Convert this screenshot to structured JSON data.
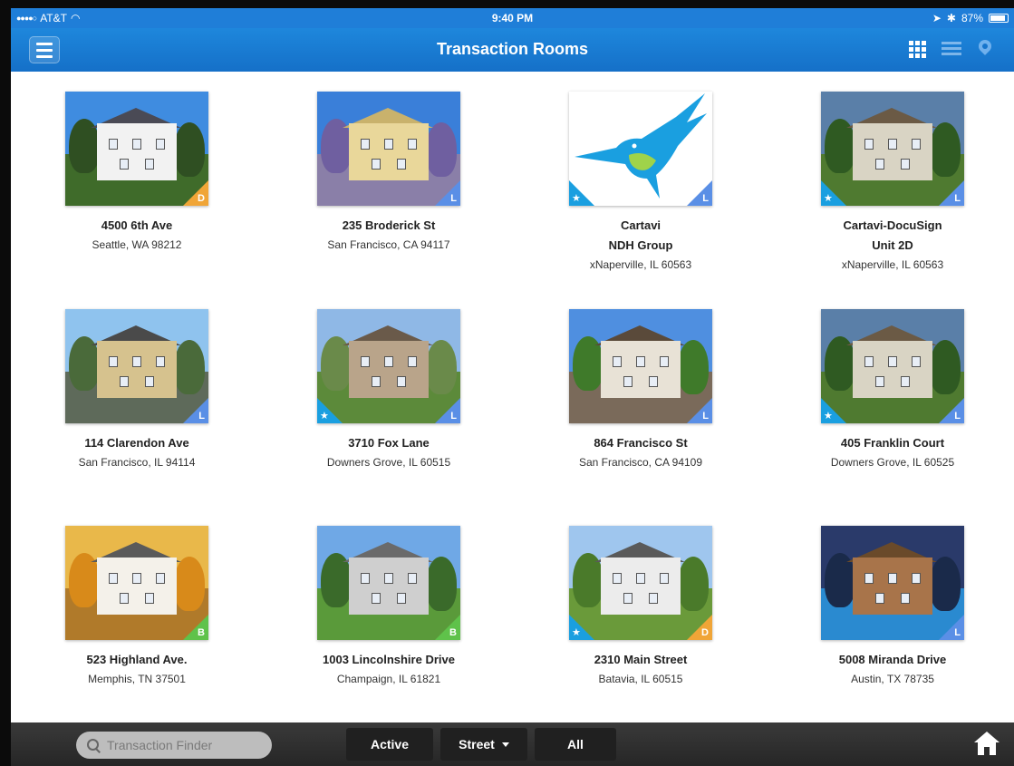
{
  "status_bar": {
    "carrier": "AT&T",
    "time": "9:40 PM",
    "battery": "87%"
  },
  "nav": {
    "title": "Transaction Rooms"
  },
  "rooms": [
    {
      "line1": "4500 6th Ave",
      "line2": "Seattle, WA 98212",
      "line3": "",
      "badge": "D",
      "starred": false,
      "photo": "victorian"
    },
    {
      "line1": "235 Broderick St",
      "line2": "San Francisco, CA 94117",
      "line3": "",
      "badge": "L",
      "starred": false,
      "photo": "painted-lady"
    },
    {
      "line1": "Cartavi",
      "line2": "NDH Group",
      "line3": "xNaperville, IL 60563",
      "badge": "L",
      "starred": true,
      "photo": "hummingbird-logo"
    },
    {
      "line1": "Cartavi-DocuSign",
      "line2": "Unit 2D",
      "line3": "xNaperville, IL 60563",
      "badge": "L",
      "starred": true,
      "photo": "colonial"
    },
    {
      "line1": "114 Clarendon Ave",
      "line2": "San Francisco, IL 94114",
      "line3": "",
      "badge": "L",
      "starred": false,
      "photo": "hillside"
    },
    {
      "line1": "3710 Fox Lane",
      "line2": "Downers Grove, IL 60515",
      "line3": "",
      "badge": "L",
      "starred": true,
      "photo": "ranch"
    },
    {
      "line1": "864 Francisco St",
      "line2": "San Francisco, CA 94109",
      "line3": "",
      "badge": "L",
      "starred": false,
      "photo": "wisteria"
    },
    {
      "line1": "405 Franklin Court",
      "line2": "Downers Grove, IL 60525",
      "line3": "",
      "badge": "L",
      "starred": true,
      "photo": "colonial"
    },
    {
      "line1": "523 Highland Ave.",
      "line2": "Memphis, TN 37501",
      "line3": "",
      "badge": "B",
      "starred": false,
      "photo": "autumn"
    },
    {
      "line1": "1003 Lincolnshire Drive",
      "line2": "Champaign, IL 61821",
      "line3": "",
      "badge": "B",
      "starred": false,
      "photo": "suburban"
    },
    {
      "line1": "2310 Main Street",
      "line2": "Batavia, IL 60515",
      "line3": "",
      "badge": "D",
      "starred": true,
      "photo": "split-level"
    },
    {
      "line1": "5008 Miranda Drive",
      "line2": "Austin, TX 78735",
      "line3": "",
      "badge": "L",
      "starred": false,
      "photo": "mansion-night"
    }
  ],
  "bottom_bar": {
    "finder_placeholder": "Transaction Finder",
    "filter_active": "Active",
    "filter_street": "Street",
    "filter_all": "All"
  },
  "colors": {
    "nav_blue": "#1a7ad4",
    "badge_D": "#f0a537",
    "badge_L": "#5a8fe6",
    "badge_B": "#5fc24a",
    "star_blue": "#1a9fe0"
  }
}
